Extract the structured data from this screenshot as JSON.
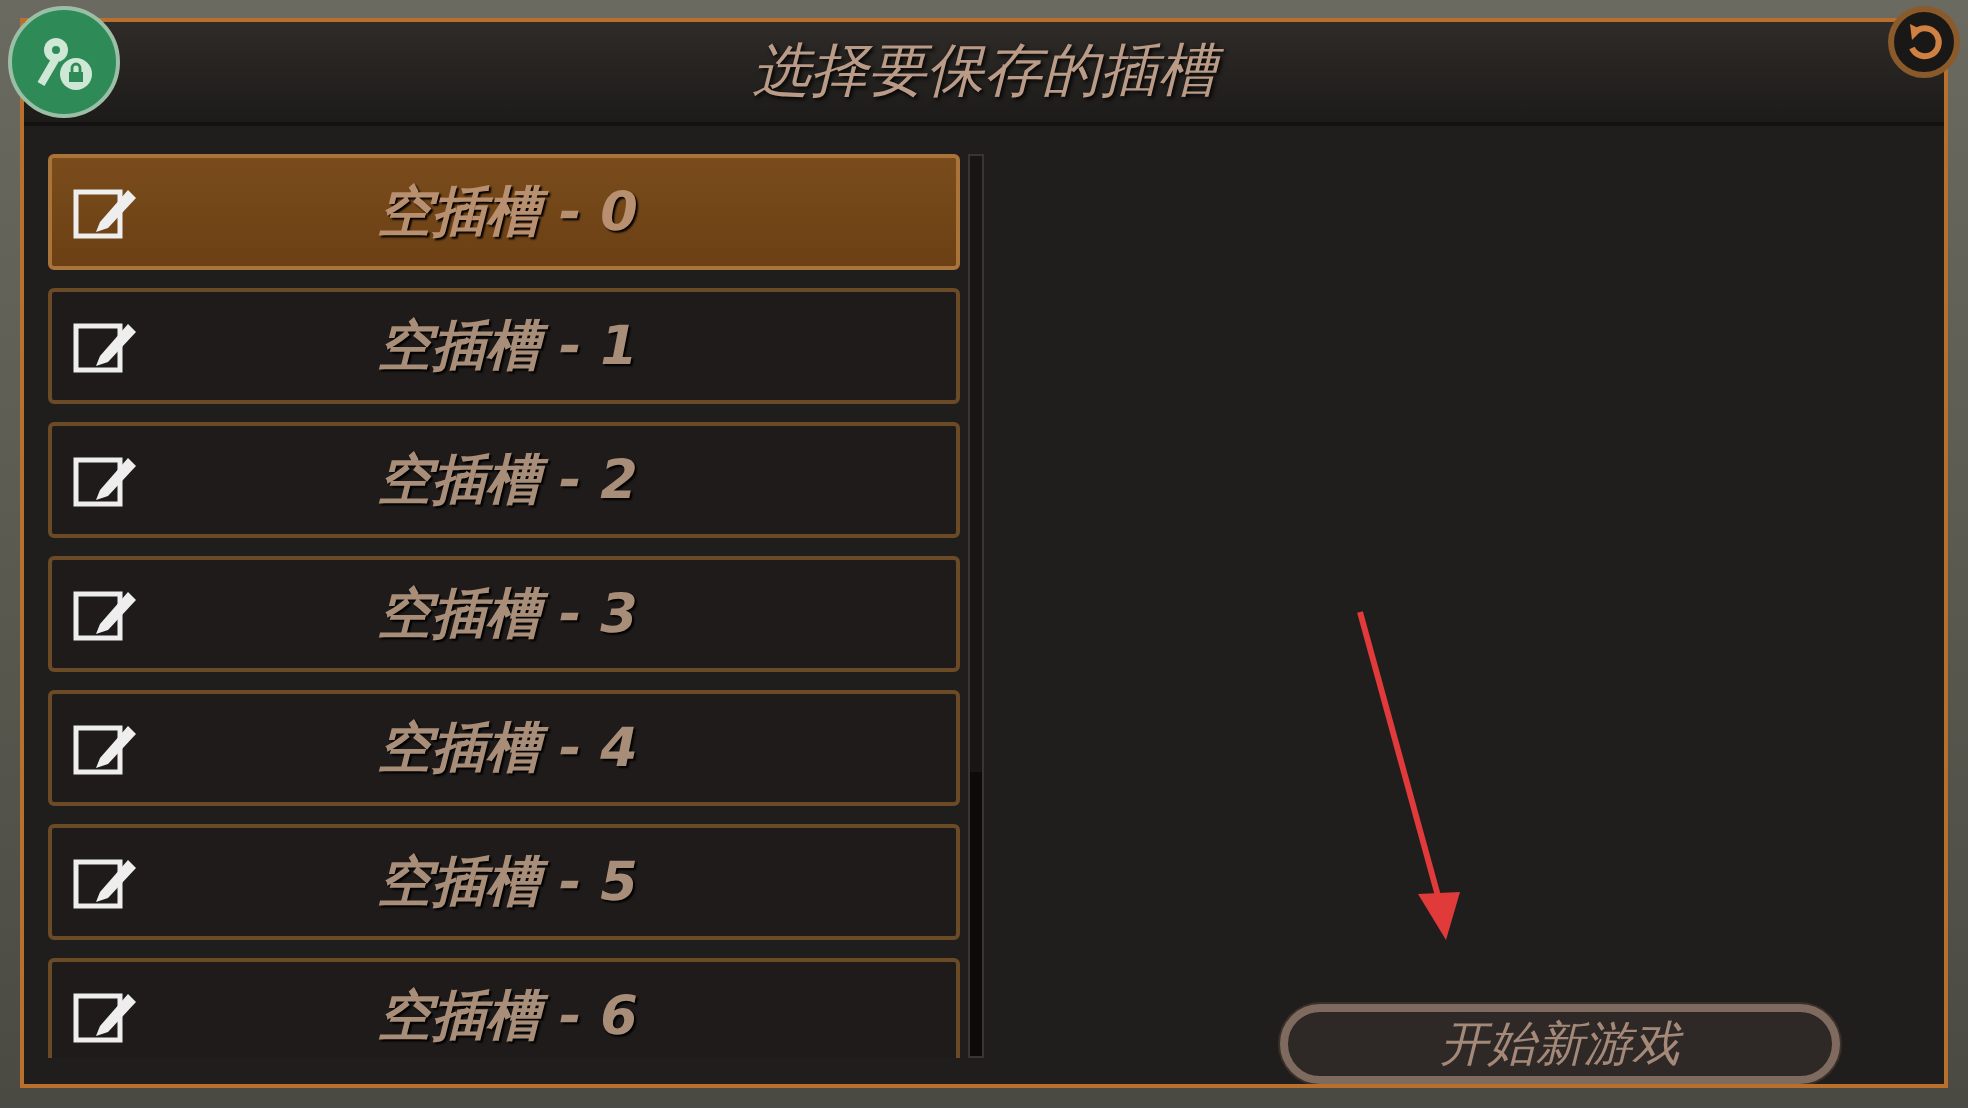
{
  "window": {
    "title": "选择要保存的插槽"
  },
  "slots": [
    {
      "label": "空插槽 - 0",
      "selected": true
    },
    {
      "label": "空插槽 - 1",
      "selected": false
    },
    {
      "label": "空插槽 - 2",
      "selected": false
    },
    {
      "label": "空插槽 - 3",
      "selected": false
    },
    {
      "label": "空插槽 - 4",
      "selected": false
    },
    {
      "label": "空插槽 - 5",
      "selected": false
    },
    {
      "label": "空插槽 - 6",
      "selected": false
    }
  ],
  "new_game_button": {
    "label": "开始新游戏"
  }
}
